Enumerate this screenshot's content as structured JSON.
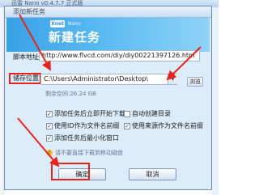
{
  "app_window": {
    "title": "迅雷 Nano v0.4.7.7 正式版"
  },
  "dialog": {
    "title": "添加新任务",
    "banner": {
      "brand_logo": "Xnet",
      "brand_text": "Nano",
      "title": "新建任务"
    },
    "url": {
      "label": "脚本地址:",
      "value": "http://www.flvcd.com/diy/diy00221397126.htm"
    },
    "save_path": {
      "label": "储存位置:",
      "value": "C:\\Users\\Administrator\\Desktop\\",
      "browse_label": "浏览",
      "free_space": "剩余空间:26.24 GB"
    },
    "options": [
      {
        "label": "添加任务后立即开始下载",
        "checked": true
      },
      {
        "label": "自动创建目录",
        "checked": false
      },
      {
        "label": "使用ID作为文件名前缀",
        "checked": true
      },
      {
        "label": "使用来源作为文件名前缀",
        "checked": true
      },
      {
        "label": "添加任务后最小化窗口",
        "checked": true
      }
    ],
    "info_text": "请不要直接下载到移动磁盘",
    "ok_label": "确定",
    "cancel_label": "取消"
  },
  "colors": {
    "annotation": "#e5251d",
    "banner": "#3aa1e6",
    "dialog_bg": "#dcecf9"
  }
}
